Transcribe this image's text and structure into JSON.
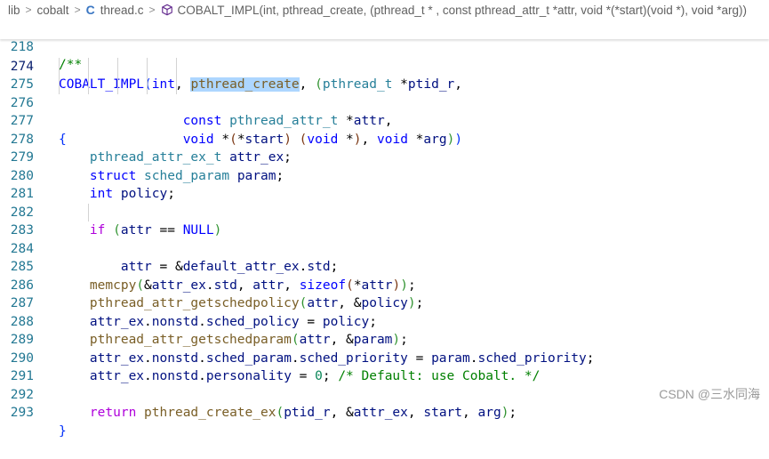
{
  "breadcrumb": {
    "part1": "lib",
    "part2": "cobalt",
    "file": "thread.c",
    "symbol": "COBALT_IMPL(int, pthread_create, (pthread_t * , const pthread_attr_t *attr, void *(*start)(void *), void *arg))",
    "separator": ">",
    "c_icon": "C"
  },
  "sticky": {
    "line_number": "218",
    "text": "/**"
  },
  "lines": [
    {
      "n": "274"
    },
    {
      "n": "275"
    },
    {
      "n": "276"
    },
    {
      "n": "277"
    },
    {
      "n": "278"
    },
    {
      "n": "279"
    },
    {
      "n": "280"
    },
    {
      "n": "281"
    },
    {
      "n": "282"
    },
    {
      "n": "283"
    },
    {
      "n": "284"
    },
    {
      "n": "285"
    },
    {
      "n": "286"
    },
    {
      "n": "287"
    },
    {
      "n": "288"
    },
    {
      "n": "289"
    },
    {
      "n": "290"
    },
    {
      "n": "291"
    },
    {
      "n": "292"
    },
    {
      "n": "293"
    }
  ],
  "tok": {
    "cobalt_impl": "COBALT_IMPL",
    "int": "int",
    "pthread_create": "pthread_create",
    "pthread_t": "pthread_t",
    "ptid_r": "ptid_r",
    "const": "const",
    "pthread_attr_t": "pthread_attr_t",
    "attr": "attr",
    "void": "void",
    "start": "start",
    "arg": "arg",
    "pthread_attr_ex_t": "pthread_attr_ex_t",
    "attr_ex": "attr_ex",
    "struct": "struct",
    "sched_param": "sched_param",
    "param": "param",
    "policy": "policy",
    "if": "if",
    "null": "NULL",
    "default_attr_ex": "default_attr_ex",
    "std": "std",
    "memcpy": "memcpy",
    "sizeof": "sizeof",
    "getschedpolicy": "pthread_attr_getschedpolicy",
    "nonstd": "nonstd",
    "sched_policy": "sched_policy",
    "getschedparam": "pthread_attr_getschedparam",
    "sched_priority": "sched_priority",
    "personality": "personality",
    "zero": "0",
    "comment": "/* Default: use Cobalt. */",
    "return": "return",
    "create_ex": "pthread_create_ex"
  },
  "watermark": "CSDN @三水同海",
  "colors": {
    "keyword": "#0000ff",
    "type": "#267f99",
    "function": "#795e26",
    "variable": "#001080",
    "control": "#af00db",
    "number": "#098658",
    "comment": "#008000",
    "line_number": "#237893",
    "selection": "#add6ff"
  }
}
